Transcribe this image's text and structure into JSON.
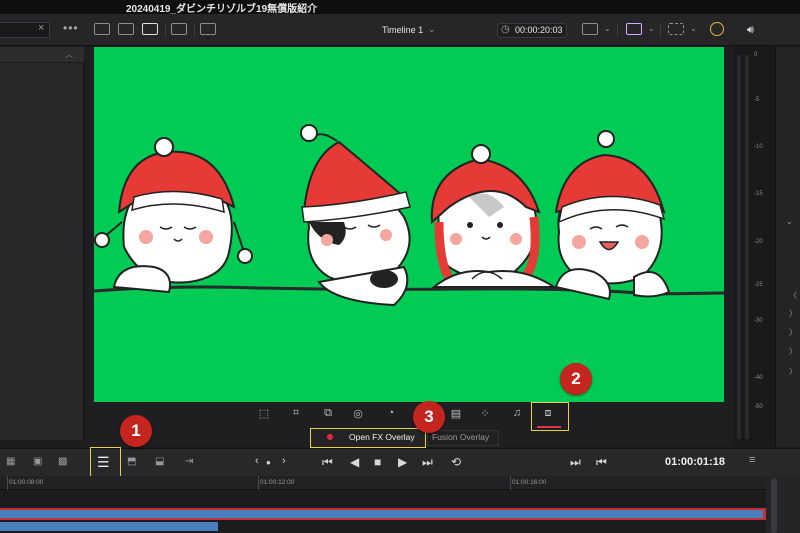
{
  "window": {
    "title": "20240419_ダビンチリゾルブ19無償版紹介"
  },
  "toolbar": {
    "search_clear": "×",
    "more": "•••",
    "timeline_title": "Timeline 1",
    "timeline_chevron": "⌄",
    "timecode": "00:00:20:03",
    "volume_icon": "speaker-icon"
  },
  "viewer": {
    "background_color": "#00cc55",
    "content": "four cartoon cats wearing red knit hats"
  },
  "audio_meter": {
    "scale": [
      "0",
      "-5",
      "-10",
      "-15",
      "-20",
      "-25",
      "-30",
      "-40",
      "-50"
    ]
  },
  "right_panel": {
    "glyphs": [
      "⌄",
      "〈",
      "〉",
      "〉",
      "〉",
      "〉",
      "〉"
    ]
  },
  "overlay_tools": {
    "icons": [
      "transform-icon",
      "crop-icon",
      "dynamic-zoom-icon",
      "open-fx-icon",
      "speed-icon",
      "annotation-icon",
      "smart-reframe-icon",
      "audio-icon",
      "fx-overlay-icon"
    ],
    "active_color": "#e0344a"
  },
  "overlay_modes": {
    "open_fx": "Open FX Overlay",
    "fusion": "Fusion Overlay"
  },
  "badges": {
    "b1": "1",
    "b2": "2",
    "b3": "3"
  },
  "transport": {
    "timecode": "01:00:01:18",
    "prev_nav": "‹",
    "next_nav": "›"
  },
  "ruler": {
    "labels": [
      "01:00:08:00",
      "01:00:12:00",
      "01:00:16:00"
    ]
  },
  "colors": {
    "highlight": "#e7d33d",
    "badge": "#c5251f",
    "clip_red": "#c33036",
    "clip_blue": "#4a7fbd"
  }
}
